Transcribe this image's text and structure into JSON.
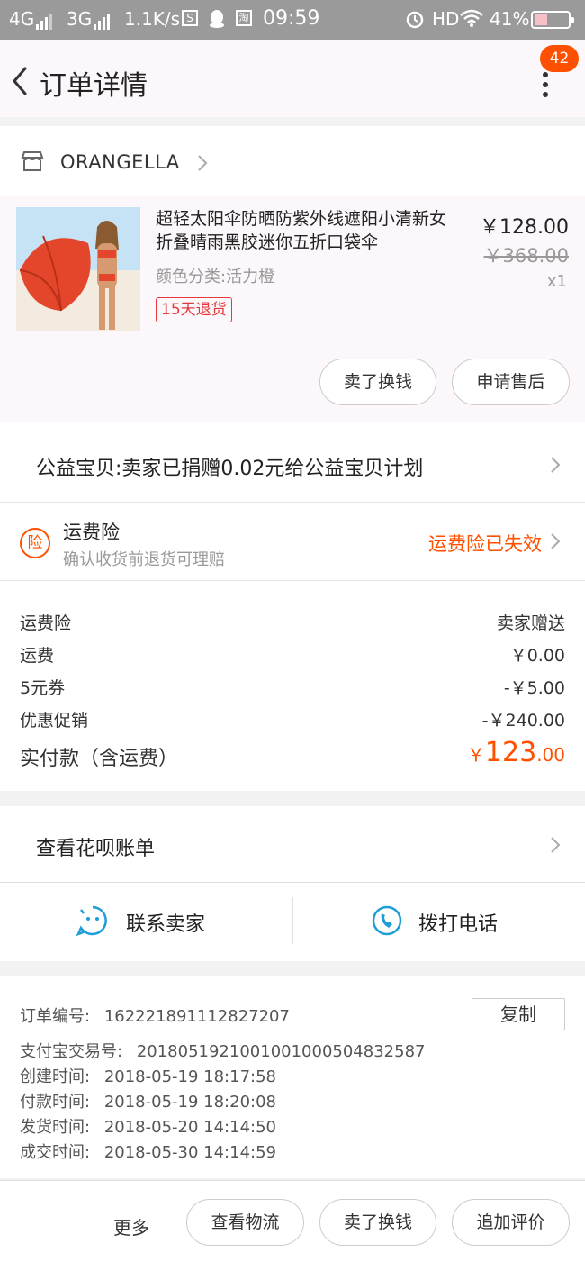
{
  "status_bar": {
    "net1": "4G",
    "net2": "3G",
    "speed": "1.1K/s",
    "time": "09:59",
    "hd": "HD",
    "battery": "41%"
  },
  "header": {
    "title": "订单详情",
    "badge": "42"
  },
  "shop": {
    "name": "ORANGELLA"
  },
  "product": {
    "title": "超轻太阳伞防晒防紫外线遮阳小清新女折叠晴雨黑胶迷你五折口袋伞",
    "sku": "颜色分类:活力橙",
    "return_tag": "15天退货",
    "price": "￥128.00",
    "original_price": "￥368.00",
    "qty": "x1",
    "sell_button": "卖了换钱",
    "aftersale_button": "申请售后"
  },
  "charity": {
    "text": "公益宝贝:卖家已捐赠0.02元给公益宝贝计划"
  },
  "insurance": {
    "icon_char": "险",
    "title": "运费险",
    "subtitle": "确认收货前退货可理赔",
    "status": "运费险已失效"
  },
  "fees": [
    {
      "label": "运费险",
      "value": "卖家赠送"
    },
    {
      "label": "运费",
      "value": "￥0.00"
    },
    {
      "label": "5元券",
      "value": "-￥5.00"
    },
    {
      "label": "优惠促销",
      "value": "-￥240.00"
    }
  ],
  "total": {
    "label": "实付款（含运费）",
    "currency": "￥",
    "integer": "123",
    "decimal": ".00"
  },
  "huabei": {
    "text": "查看花呗账单"
  },
  "contact": {
    "seller": "联系卖家",
    "phone": "拨打电话"
  },
  "order_info": {
    "order_no_label": "订单编号:",
    "order_no": "162221891112827207",
    "copy_button": "复制",
    "alipay_label": "支付宝交易号:",
    "alipay_no": "2018051921001001000504832587",
    "created_label": "创建时间:",
    "created": "2018-05-19 18:17:58",
    "paid_label": "付款时间:",
    "paid": "2018-05-19 18:20:08",
    "shipped_label": "发货时间:",
    "shipped": "2018-05-20 14:14:50",
    "completed_label": "成交时间:",
    "completed": "2018-05-30 14:14:59"
  },
  "bottom_bar": {
    "more": "更多",
    "logistics_button": "查看物流",
    "sell_button": "卖了换钱",
    "review_button": "追加评价"
  },
  "colors": {
    "accent": "#ff5000",
    "tag_red": "#e4393c",
    "contact_blue": "#1e9ed8"
  }
}
